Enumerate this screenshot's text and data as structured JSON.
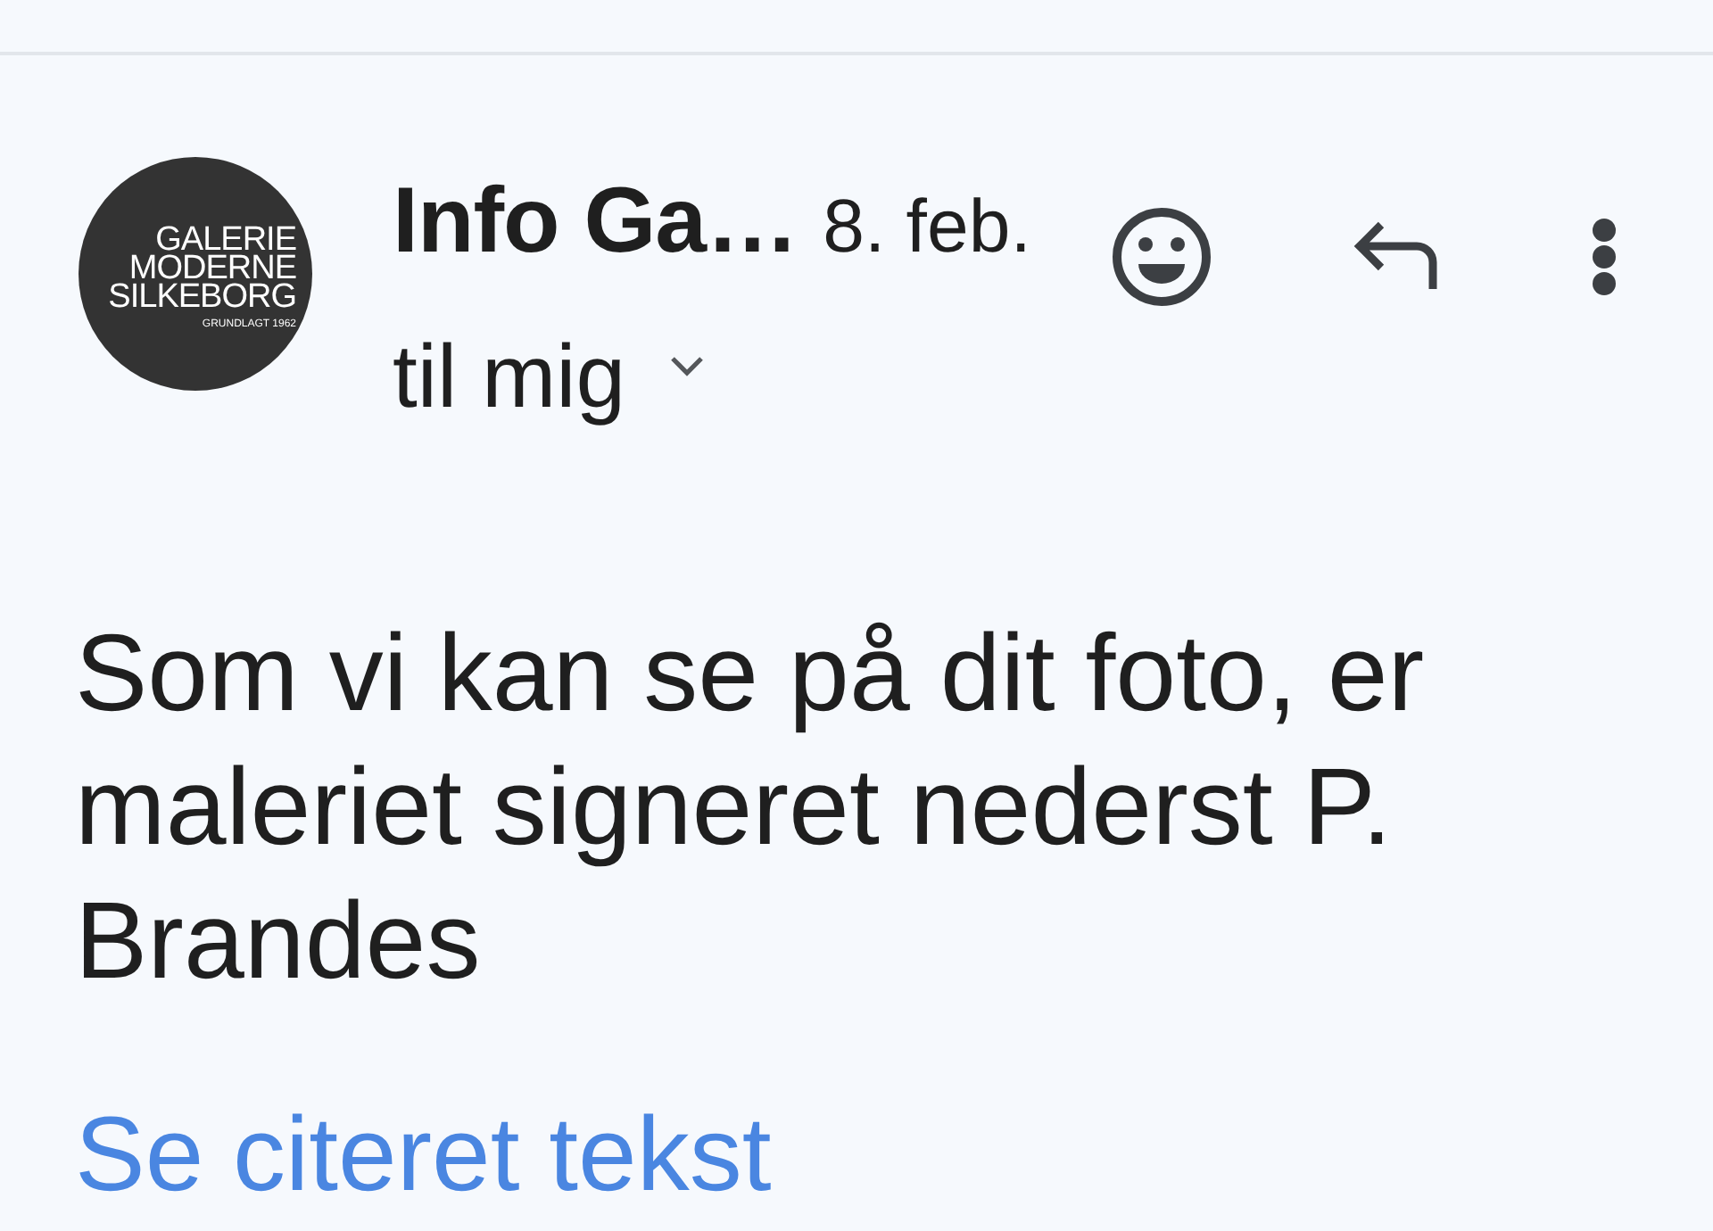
{
  "message": {
    "sender_logo": {
      "lines": [
        "GALERIE",
        "MODERNE",
        "SILKEBORG"
      ],
      "tagline": "GRUNDLAGT 1962"
    },
    "sender": "Info Ga…",
    "date": "8. feb.",
    "recipient": "til mig",
    "recipient_expanded": false,
    "body": "Som vi kan se på dit foto, er maleriet signeret nederst P. Brandes",
    "quoted_text_link": "Se citeret tekst"
  }
}
